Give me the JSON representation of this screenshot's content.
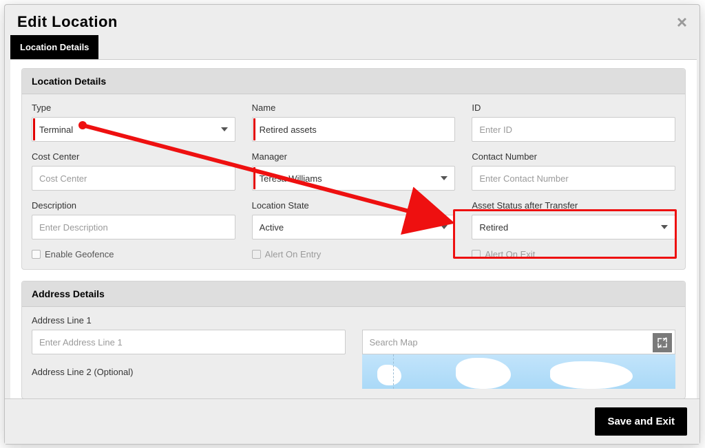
{
  "dialog": {
    "title": "Edit Location"
  },
  "tabs": {
    "details_label": "Location Details"
  },
  "location_details": {
    "section_title": "Location Details",
    "type_label": "Type",
    "type_value": "Terminal",
    "name_label": "Name",
    "name_value": "Retired assets",
    "id_label": "ID",
    "id_placeholder": "Enter ID",
    "cost_center_label": "Cost Center",
    "cost_center_placeholder": "Cost Center",
    "manager_label": "Manager",
    "manager_value": "Teresa Williams",
    "contact_label": "Contact Number",
    "contact_placeholder": "Enter Contact Number",
    "description_label": "Description",
    "description_placeholder": "Enter Description",
    "state_label": "Location State",
    "state_value": "Active",
    "asset_status_label": "Asset Status after Transfer",
    "asset_status_value": "Retired",
    "enable_geofence": "Enable Geofence",
    "alert_entry": "Alert On Entry",
    "alert_exit": "Alert On Exit"
  },
  "address_details": {
    "section_title": "Address Details",
    "line1_label": "Address Line 1",
    "line1_placeholder": "Enter Address Line 1",
    "line2_label": "Address Line 2 (Optional)",
    "map_search_placeholder": "Search Map"
  },
  "footer": {
    "save_label": "Save and Exit"
  },
  "icons": {
    "close": "×"
  }
}
